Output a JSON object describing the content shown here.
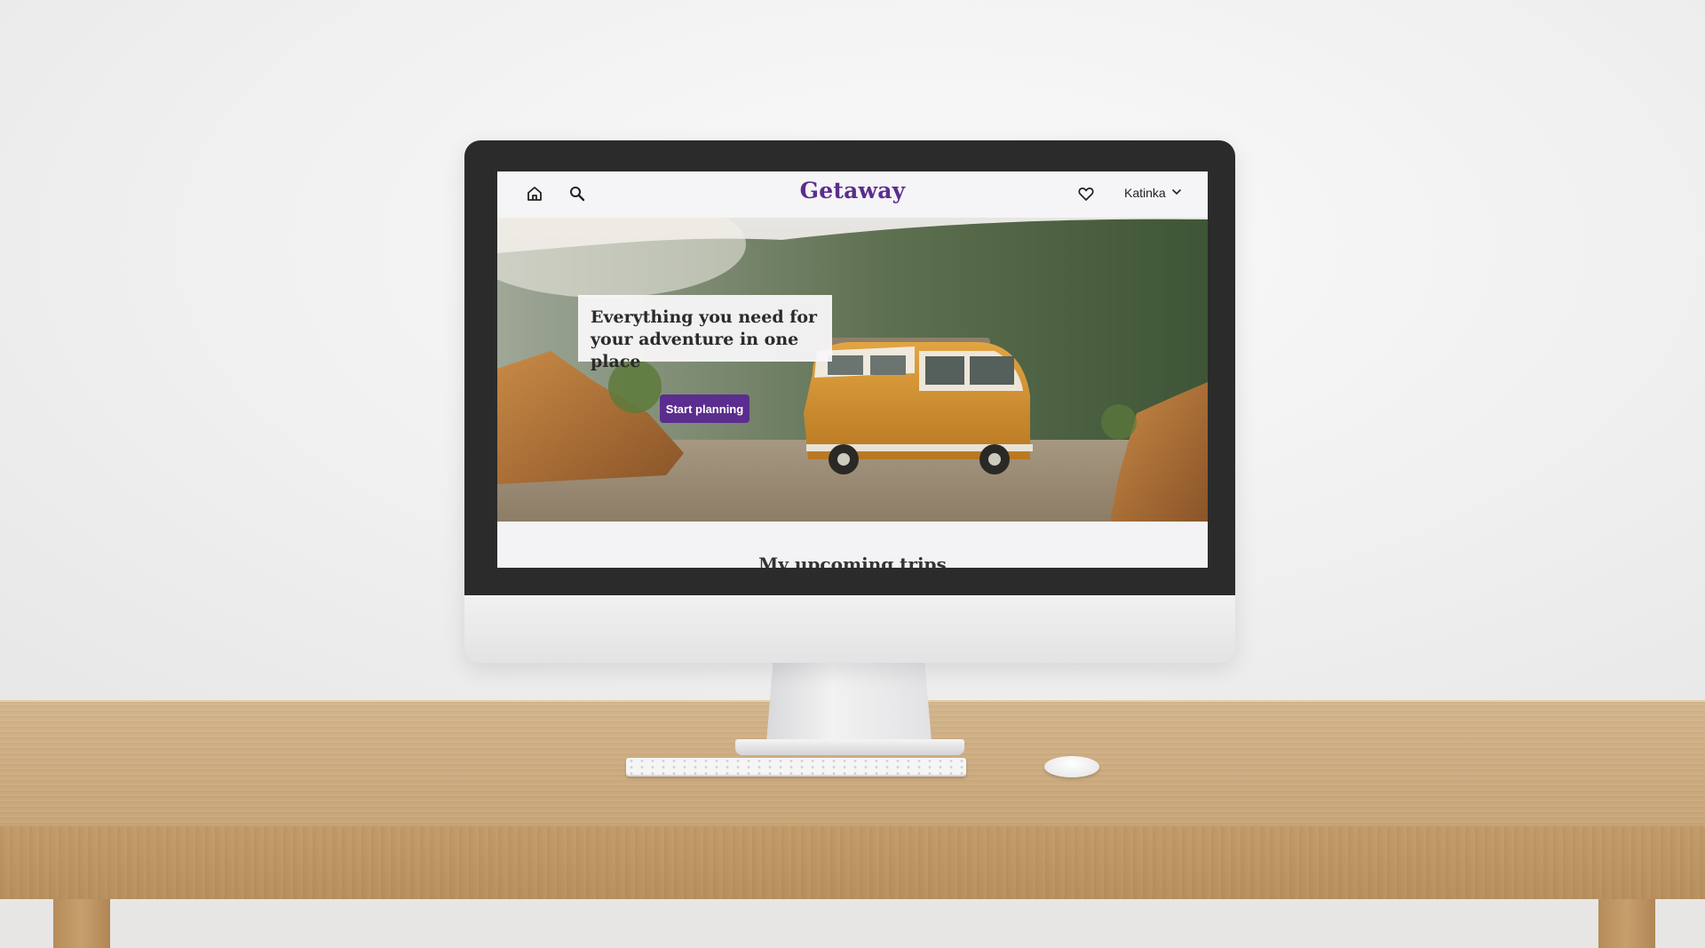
{
  "app": {
    "logo": "Getaway"
  },
  "nav": {
    "home_icon": "home-icon",
    "search_icon": "search-icon",
    "favorites_icon": "heart-icon",
    "user_name": "Katinka",
    "user_menu_icon": "chevron-down-icon"
  },
  "hero": {
    "headline_line1": "Everything you need for",
    "headline_line2": "your adventure in one place",
    "cta_label": "Start planning"
  },
  "sections": {
    "upcoming_title": "My upcoming trips"
  },
  "colors": {
    "brand": "#5b2d8e",
    "cta_text": "#ffffff"
  }
}
